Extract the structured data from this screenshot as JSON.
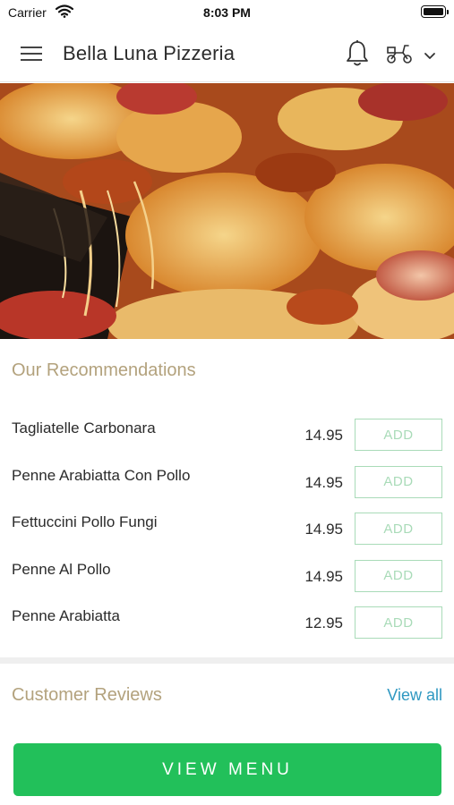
{
  "status_bar": {
    "carrier": "Carrier",
    "time": "8:03 PM"
  },
  "nav": {
    "title": "Bella Luna Pizzeria",
    "icons": [
      "hamburger-menu-icon",
      "bell-icon",
      "scooter-icon",
      "chevron-down-icon"
    ]
  },
  "hero": {
    "image": "cheesy-pizza-photo"
  },
  "recommendations": {
    "title": "Our Recommendations",
    "items": [
      {
        "name": "Tagliatelle Carbonara",
        "price": "14.95",
        "add_label": "ADD"
      },
      {
        "name": "Penne Arabiatta Con Pollo",
        "price": "14.95",
        "add_label": "ADD"
      },
      {
        "name": "Fettuccini Pollo Fungi",
        "price": "14.95",
        "add_label": "ADD"
      },
      {
        "name": "Penne Al Pollo",
        "price": "14.95",
        "add_label": "ADD"
      },
      {
        "name": "Penne Arabiatta",
        "price": "12.95",
        "add_label": "ADD"
      }
    ]
  },
  "reviews": {
    "title": "Customer Reviews",
    "view_all": "View all"
  },
  "footer": {
    "view_menu_label": "VIEW MENU"
  },
  "colors": {
    "accent_green": "#22c05a",
    "add_border": "#a9dbb8",
    "section_title": "#b3a27d",
    "link_blue": "#2f98c1"
  }
}
